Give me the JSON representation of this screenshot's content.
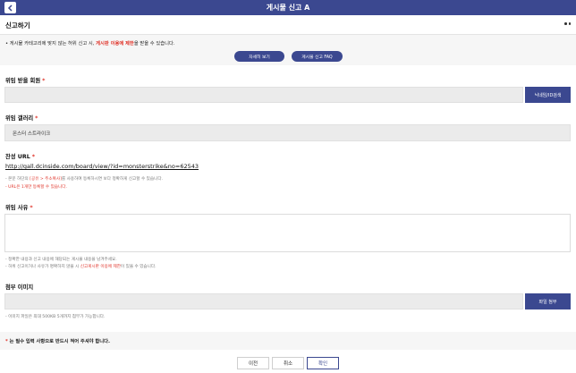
{
  "topbar": {
    "title": "게시물 신고 A",
    "back_icon": "chevron-left-icon"
  },
  "subheader": {
    "title": "신고하기",
    "more_icon": "more-dots-icon"
  },
  "notice": {
    "bullet": "•",
    "text_before": " 게시물 카테고리에 맞지 않는 허위 신고 시, ",
    "text_highlight": "게시판 이용에 제한",
    "text_after": "을 받을 수 있습니다.",
    "highlight_color": "#e0352b"
  },
  "buttons": {
    "details": "자세히 보기",
    "faq": "게시물 신고 FAQ",
    "nickname_search": "닉네임/ID검색",
    "file_attach": "파일 첨부"
  },
  "fields": {
    "target_user": {
      "label": "위임 받을 회원",
      "required": "*",
      "value": ""
    },
    "gallery": {
      "label": "위임 갤러리",
      "required": "*",
      "value": "몬스터 스트라이크"
    },
    "recommend_url": {
      "label": "찬성 URL",
      "required": "*",
      "value": "http://gall.dcinside.com/board/view/?id=monsterstrike&no=62543",
      "hint1_before": "- 본문 하단의 ",
      "hint1_blue": "[공유 > 주소복사]",
      "hint1_after": "를 사용하여 등록하시면 보다 정확하게 신고할 수 있습니다.",
      "hint2": "- URL은 1개만 등록할 수 있습니다."
    },
    "reason": {
      "label": "위임 사유",
      "required": "*",
      "value": "",
      "hint1": "- 정확한 내용과 신고 내용에 해당되는 게시물 내용을 남겨주세요.",
      "hint2_before": "- 허위 신고이거나 사유가 명확하지 않을 시 ",
      "hint2_red": "신고게시판 이용에 제한",
      "hint2_after": "이 있을 수 있습니다."
    },
    "attachment": {
      "label": "첨부 이미지",
      "value": "",
      "hint": "- 이미지 파일은 최대 500KB 5개까지 첨부가 가능합니다."
    }
  },
  "bottom_notice": {
    "star": "*",
    "text": " 는 필수 입력 사항으로 반드시 적어 주셔야 합니다."
  },
  "footer": {
    "prev": "이전",
    "cancel": "취소",
    "confirm": "확인"
  },
  "colors": {
    "brand": "#3b4890",
    "required": "#e0352b",
    "link_blue": "#1a4bbf"
  }
}
